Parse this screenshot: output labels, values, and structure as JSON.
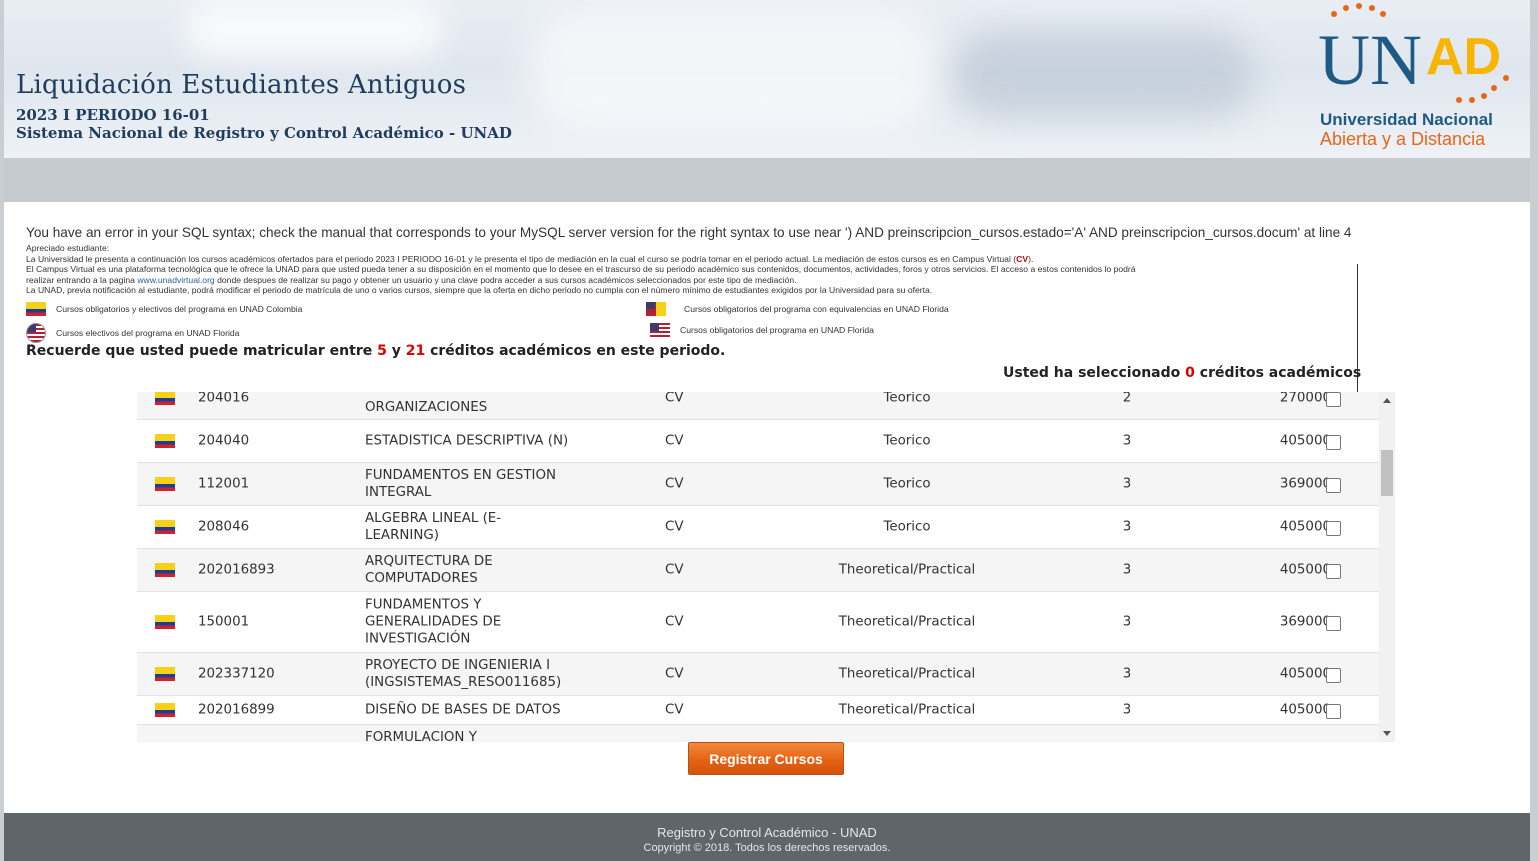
{
  "header": {
    "title": "Liquidación Estudiantes Antiguos",
    "period": "2023 I PERIODO 16-01",
    "system": "Sistema Nacional de Registro y Control Académico - UNAD",
    "logo_top_left": "UN",
    "logo_top_right": "AD",
    "logo_line1": "Universidad Nacional",
    "logo_line2": "Abierta y a Distancia",
    "colors": {
      "brand_blue": "#1f5a85",
      "brand_orange": "#e8661a",
      "brand_yellow": "#f7b500"
    }
  },
  "error_message": "You have an error in your SQL syntax; check the manual that corresponds to your MySQL server version for the right syntax to use near ') AND preinscripcion_cursos.estado='A' AND preinscripcion_cursos.docum' at line 4",
  "notice": {
    "greeting": "Apreciado estudiante:",
    "line1_a": "La Universidad le presenta a continuación los cursos académicos ofertados para el periodo 2023 I PERIODO 16-01 y le presenta el tipo de mediación en la cual el curso se podría tomar en el periodo actual. La mediación de estos cursos es en Campus Virtual (",
    "line1_cv": "CV",
    "line1_b": ").",
    "line2": "El Campus Virtual es una plataforma tecnológica que le ofrece la UNAD para que usted pueda tener a su disposición en el momento que lo desee en el trascurso de su periodo académico sus contenidos, documentos, actividades, foros y otros servicios. El acceso a estos contenidos lo podrá",
    "line3_a": "realizar entrando a la pagina ",
    "line3_link": "www.unadvirtual.org",
    "line3_b": " donde despues de realizar su pago y obtener un usuario y una clave podra acceder a sus cursos académicos seleccionados por este tipo de mediación.",
    "line4": "La UNAD, previa notificación al estudiante, podrá modificar el periodo de matrícula de uno o varios cursos, siempre que la oferta en dicho periodo no cumpla con el número mínimo de estudiantes exigidos por la Universidad para su oferta."
  },
  "legend": {
    "colombia": "Cursos obligatorios y electivos del programa en UNAD Colombia",
    "equivalencias": "Cursos obligatorios del programa con equivalencias en UNAD Florida",
    "electivos_florida": "Cursos electivos del programa en UNAD Florida",
    "obligatorios_florida": "Cursos obligatorios del programa en UNAD Florida"
  },
  "credits_text": {
    "prefix": "Recuerde que usted puede matricular entre ",
    "min": "5",
    "mid": " y ",
    "max": "21",
    "suffix": " créditos académicos en este periodo."
  },
  "selected_text": {
    "prefix": "Usted ha seleccionado ",
    "count": "0",
    "suffix": " créditos académicos"
  },
  "courses": [
    {
      "code": "204016",
      "name": "ORGANIZACIONES",
      "mediation": "CV",
      "type": "Teorico",
      "credits": "2",
      "price": "270000"
    },
    {
      "code": "204040",
      "name": "ESTADISTICA DESCRIPTIVA (N)",
      "mediation": "CV",
      "type": "Teorico",
      "credits": "3",
      "price": "405000"
    },
    {
      "code": "112001",
      "name": "FUNDAMENTOS EN GESTION INTEGRAL",
      "mediation": "CV",
      "type": "Teorico",
      "credits": "3",
      "price": "369000"
    },
    {
      "code": "208046",
      "name": "ALGEBRA LINEAL (E-LEARNING)",
      "mediation": "CV",
      "type": "Teorico",
      "credits": "3",
      "price": "405000"
    },
    {
      "code": "202016893",
      "name": "ARQUITECTURA DE COMPUTADORES",
      "mediation": "CV",
      "type": "Theoretical/Practical",
      "credits": "3",
      "price": "405000"
    },
    {
      "code": "150001",
      "name": "FUNDAMENTOS Y GENERALIDADES DE INVESTIGACIÓN",
      "mediation": "CV",
      "type": "Theoretical/Practical",
      "credits": "3",
      "price": "369000"
    },
    {
      "code": "202337120",
      "name": "PROYECTO DE INGENIERIA I (INGSISTEMAS_RESO011685)",
      "mediation": "CV",
      "type": "Theoretical/Practical",
      "credits": "3",
      "price": "405000"
    },
    {
      "code": "202016899",
      "name": "DISEÑO DE BASES DE DATOS",
      "mediation": "CV",
      "type": "Theoretical/Practical",
      "credits": "3",
      "price": "405000"
    },
    {
      "code": "",
      "name": "FORMULACION Y",
      "mediation": "",
      "type": "",
      "credits": "",
      "price": ""
    }
  ],
  "register_button": "Registrar Cursos",
  "footer": {
    "line1": "Registro y Control Académico - UNAD",
    "line2": "Copyright © 2018. Todos los derechos reservados."
  }
}
